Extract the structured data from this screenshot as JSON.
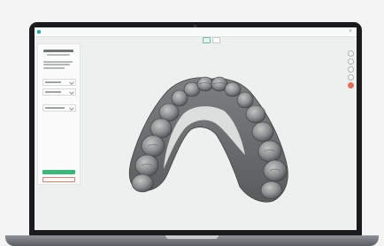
{
  "app": {
    "brand_color": "#2fa8a0",
    "close_icon": "close-icon"
  },
  "toolbar": {
    "view_modes": [
      "single-view-icon",
      "split-view-icon"
    ],
    "active_mode": "single-view-icon"
  },
  "side_panel": {
    "primary_color": "#39b879",
    "secondary_border_color": "#e27e74"
  },
  "right_tools": {
    "icons": [
      "view-icon",
      "rotate-icon",
      "measure-icon",
      "settings-icon",
      "delete-icon"
    ],
    "alert_color": "#e56b5a"
  },
  "viewport": {
    "content": "dental-arch-scan"
  }
}
